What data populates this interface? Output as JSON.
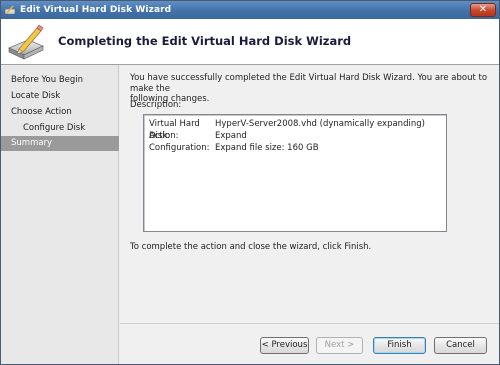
{
  "window": {
    "title": "Edit Virtual Hard Disk Wizard",
    "close_symbol": "✕"
  },
  "header": {
    "title": "Completing the Edit Virtual Hard Disk Wizard",
    "icon": "disk-pencil-icon"
  },
  "nav": {
    "items": [
      {
        "label": "Before You Begin"
      },
      {
        "label": "Locate Disk"
      },
      {
        "label": "Choose Action"
      },
      {
        "label": "Configure Disk"
      },
      {
        "label": "Summary"
      }
    ],
    "selected_index": 4
  },
  "main": {
    "intro_line1": "You have successfully completed the Edit Virtual Hard Disk Wizard. You are about to make the",
    "intro_line2": "following changes.",
    "description_label": "Description:",
    "description": [
      {
        "key": "Virtual Hard Disk:",
        "value": "HyperV-Server2008.vhd (dynamically expanding)"
      },
      {
        "key": "Action:",
        "value": "Expand"
      },
      {
        "key": "Configuration:",
        "value": "Expand file size: 160 GB"
      }
    ],
    "finish_note": "To complete the action and close the wizard, click Finish."
  },
  "buttons": {
    "previous": "< Previous",
    "next": "Next >",
    "finish": "Finish",
    "cancel": "Cancel"
  },
  "colors": {
    "titlebar": "#4372ab",
    "nav_selected": "#9a9a9a",
    "close_button": "#c7452b"
  }
}
